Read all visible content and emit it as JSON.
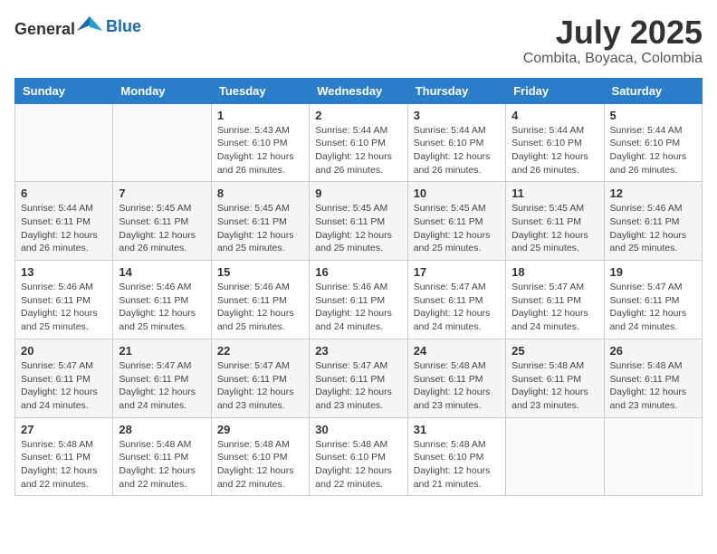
{
  "logo": {
    "general": "General",
    "blue": "Blue"
  },
  "header": {
    "month": "July 2025",
    "location": "Combita, Boyaca, Colombia"
  },
  "weekdays": [
    "Sunday",
    "Monday",
    "Tuesday",
    "Wednesday",
    "Thursday",
    "Friday",
    "Saturday"
  ],
  "weeks": [
    [
      null,
      null,
      {
        "day": 1,
        "sunrise": "5:43 AM",
        "sunset": "6:10 PM",
        "daylight": "12 hours and 26 minutes."
      },
      {
        "day": 2,
        "sunrise": "5:44 AM",
        "sunset": "6:10 PM",
        "daylight": "12 hours and 26 minutes."
      },
      {
        "day": 3,
        "sunrise": "5:44 AM",
        "sunset": "6:10 PM",
        "daylight": "12 hours and 26 minutes."
      },
      {
        "day": 4,
        "sunrise": "5:44 AM",
        "sunset": "6:10 PM",
        "daylight": "12 hours and 26 minutes."
      },
      {
        "day": 5,
        "sunrise": "5:44 AM",
        "sunset": "6:10 PM",
        "daylight": "12 hours and 26 minutes."
      }
    ],
    [
      {
        "day": 6,
        "sunrise": "5:44 AM",
        "sunset": "6:11 PM",
        "daylight": "12 hours and 26 minutes."
      },
      {
        "day": 7,
        "sunrise": "5:45 AM",
        "sunset": "6:11 PM",
        "daylight": "12 hours and 26 minutes."
      },
      {
        "day": 8,
        "sunrise": "5:45 AM",
        "sunset": "6:11 PM",
        "daylight": "12 hours and 25 minutes."
      },
      {
        "day": 9,
        "sunrise": "5:45 AM",
        "sunset": "6:11 PM",
        "daylight": "12 hours and 25 minutes."
      },
      {
        "day": 10,
        "sunrise": "5:45 AM",
        "sunset": "6:11 PM",
        "daylight": "12 hours and 25 minutes."
      },
      {
        "day": 11,
        "sunrise": "5:45 AM",
        "sunset": "6:11 PM",
        "daylight": "12 hours and 25 minutes."
      },
      {
        "day": 12,
        "sunrise": "5:46 AM",
        "sunset": "6:11 PM",
        "daylight": "12 hours and 25 minutes."
      }
    ],
    [
      {
        "day": 13,
        "sunrise": "5:46 AM",
        "sunset": "6:11 PM",
        "daylight": "12 hours and 25 minutes."
      },
      {
        "day": 14,
        "sunrise": "5:46 AM",
        "sunset": "6:11 PM",
        "daylight": "12 hours and 25 minutes."
      },
      {
        "day": 15,
        "sunrise": "5:46 AM",
        "sunset": "6:11 PM",
        "daylight": "12 hours and 25 minutes."
      },
      {
        "day": 16,
        "sunrise": "5:46 AM",
        "sunset": "6:11 PM",
        "daylight": "12 hours and 24 minutes."
      },
      {
        "day": 17,
        "sunrise": "5:47 AM",
        "sunset": "6:11 PM",
        "daylight": "12 hours and 24 minutes."
      },
      {
        "day": 18,
        "sunrise": "5:47 AM",
        "sunset": "6:11 PM",
        "daylight": "12 hours and 24 minutes."
      },
      {
        "day": 19,
        "sunrise": "5:47 AM",
        "sunset": "6:11 PM",
        "daylight": "12 hours and 24 minutes."
      }
    ],
    [
      {
        "day": 20,
        "sunrise": "5:47 AM",
        "sunset": "6:11 PM",
        "daylight": "12 hours and 24 minutes."
      },
      {
        "day": 21,
        "sunrise": "5:47 AM",
        "sunset": "6:11 PM",
        "daylight": "12 hours and 24 minutes."
      },
      {
        "day": 22,
        "sunrise": "5:47 AM",
        "sunset": "6:11 PM",
        "daylight": "12 hours and 23 minutes."
      },
      {
        "day": 23,
        "sunrise": "5:47 AM",
        "sunset": "6:11 PM",
        "daylight": "12 hours and 23 minutes."
      },
      {
        "day": 24,
        "sunrise": "5:48 AM",
        "sunset": "6:11 PM",
        "daylight": "12 hours and 23 minutes."
      },
      {
        "day": 25,
        "sunrise": "5:48 AM",
        "sunset": "6:11 PM",
        "daylight": "12 hours and 23 minutes."
      },
      {
        "day": 26,
        "sunrise": "5:48 AM",
        "sunset": "6:11 PM",
        "daylight": "12 hours and 23 minutes."
      }
    ],
    [
      {
        "day": 27,
        "sunrise": "5:48 AM",
        "sunset": "6:11 PM",
        "daylight": "12 hours and 22 minutes."
      },
      {
        "day": 28,
        "sunrise": "5:48 AM",
        "sunset": "6:11 PM",
        "daylight": "12 hours and 22 minutes."
      },
      {
        "day": 29,
        "sunrise": "5:48 AM",
        "sunset": "6:10 PM",
        "daylight": "12 hours and 22 minutes."
      },
      {
        "day": 30,
        "sunrise": "5:48 AM",
        "sunset": "6:10 PM",
        "daylight": "12 hours and 22 minutes."
      },
      {
        "day": 31,
        "sunrise": "5:48 AM",
        "sunset": "6:10 PM",
        "daylight": "12 hours and 21 minutes."
      },
      null,
      null
    ]
  ],
  "labels": {
    "sunrise_prefix": "Sunrise: ",
    "sunset_prefix": "Sunset: ",
    "daylight_prefix": "Daylight: "
  }
}
